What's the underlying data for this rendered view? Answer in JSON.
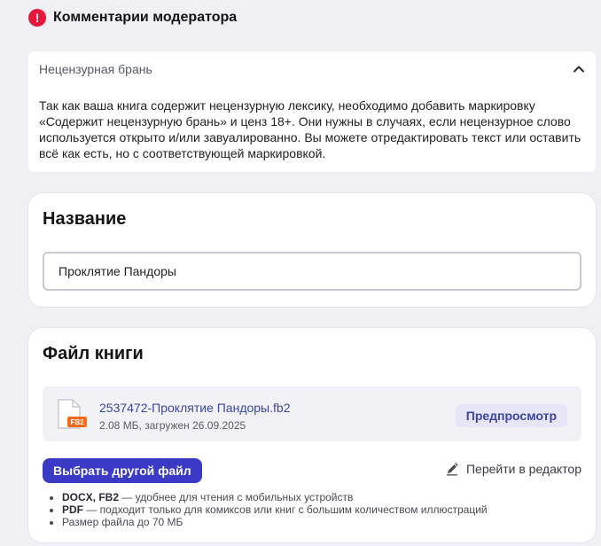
{
  "moderator": {
    "title": "Комментарии модератора",
    "alert_icon": "!",
    "comment": {
      "category": "Нецензурная брань",
      "text": "Так как ваша книга содержит нецензурную лексику, необходимо добавить маркировку «Содержит нецензурную брань» и ценз 18+. Они нужны в случаях, если нецензурное слово используется открыто и/или завуалированно. Вы можете отредактировать текст или оставить всё как есть, но с соответствующей маркировкой."
    }
  },
  "name_section": {
    "title": "Название",
    "value": "Проклятие Пандоры"
  },
  "file_section": {
    "title": "Файл книги",
    "file": {
      "badge": "FB2",
      "name": "2537472-Проклятие Пандоры.fb2",
      "meta": "2.08 МБ, загружен 26.09.2025"
    },
    "preview_label": "Предпросмотр",
    "choose_label": "Выбрать другой файл",
    "editor_label": "Перейти в редактор",
    "requirements": [
      {
        "format": "DOCX, FB2",
        "desc": " — удобнее для чтения с мобильных устройств"
      },
      {
        "format": "PDF",
        "desc": " — подходит только для комиксов или книг с большим количеством иллюстраций"
      },
      {
        "format": "",
        "desc": "Размер файла до 70 МБ"
      }
    ]
  },
  "colors": {
    "accent": "#3a3ac6",
    "alert": "#e8173c",
    "link": "#3c46a0",
    "badge": "#f26b1d"
  }
}
